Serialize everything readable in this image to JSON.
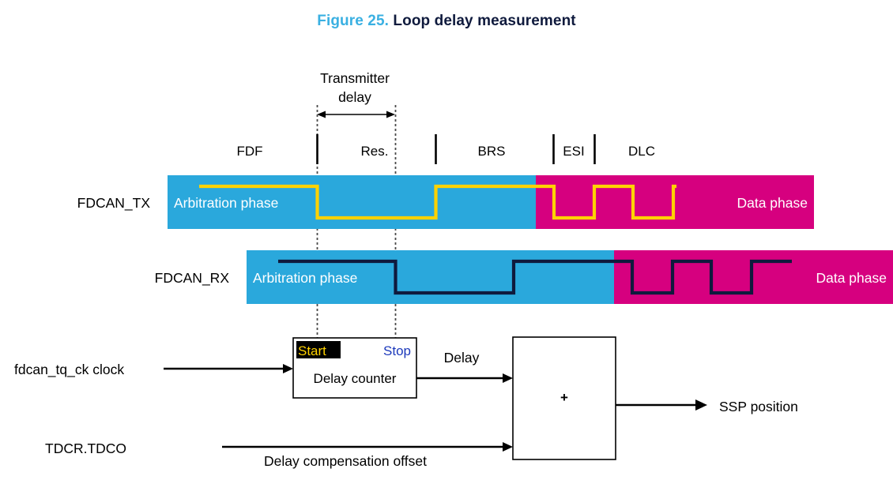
{
  "figure": {
    "number_label": "Figure 25.",
    "title": "Loop delay measurement",
    "number_color": "#3ab0e2",
    "title_color": "#0f1a3d"
  },
  "colors": {
    "arbitration_phase": "#2aa8dc",
    "data_phase": "#d6007f",
    "tx_wave": "#ffd200",
    "rx_wave": "#0f1a3d",
    "highlight_bg": "#000000",
    "start_text": "#ffd200",
    "stop_text": "#1c39bb"
  },
  "annotations": {
    "transmitter_delay_line1": "Transmitter",
    "transmitter_delay_line2": "delay"
  },
  "bit_fields": [
    {
      "label": "FDF"
    },
    {
      "label": "Res."
    },
    {
      "label": "BRS"
    },
    {
      "label": "ESI"
    },
    {
      "label": "DLC"
    }
  ],
  "signals": [
    {
      "name": "FDCAN_TX",
      "arbitration_label": "Arbitration phase",
      "data_label": "Data phase"
    },
    {
      "name": "FDCAN_RX",
      "arbitration_label": "Arbitration phase",
      "data_label": "Data phase"
    }
  ],
  "blocks": {
    "delay_counter": {
      "title": "Delay counter",
      "start_label": "Start",
      "stop_label": "Stop"
    },
    "adder": {
      "symbol": "+"
    }
  },
  "inputs": {
    "clock": "fdcan_tq_ck clock",
    "tdco_register": "TDCR.TDCO"
  },
  "wire_labels": {
    "delay": "Delay",
    "offset": "Delay compensation offset"
  },
  "outputs": {
    "ssp_position": "SSP position"
  }
}
